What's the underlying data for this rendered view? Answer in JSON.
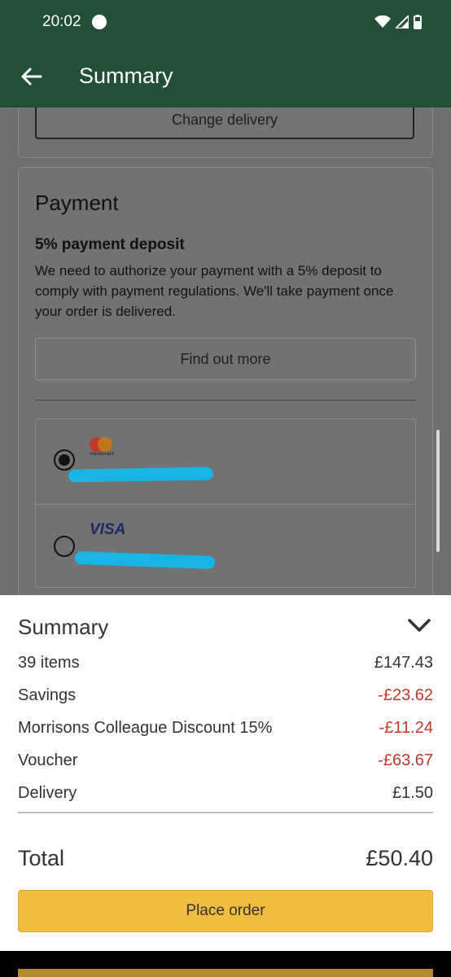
{
  "status_bar": {
    "time": "20:02"
  },
  "app_bar": {
    "title": "Summary"
  },
  "delivery": {
    "change_label": "Change delivery"
  },
  "payment": {
    "title": "Payment",
    "deposit_title": "5% payment deposit",
    "deposit_text": "We need to authorize your payment with a 5% deposit to comply with payment regulations. We'll take payment once your order is delivered.",
    "find_out_label": "Find out more",
    "cards": [
      {
        "brand": "mastercard",
        "selected": true
      },
      {
        "brand": "VISA",
        "selected": false
      }
    ]
  },
  "summary": {
    "title": "Summary",
    "rows": [
      {
        "label": "39 items",
        "value": "£147.43",
        "type": "pos"
      },
      {
        "label": "Savings",
        "value": "-£23.62",
        "type": "neg"
      },
      {
        "label": "Morrisons Colleague Discount 15%",
        "value": "-£11.24",
        "type": "neg"
      },
      {
        "label": "Voucher",
        "value": "-£63.67",
        "type": "neg"
      },
      {
        "label": "Delivery",
        "value": "£1.50",
        "type": "pos"
      }
    ],
    "total_label": "Total",
    "total_value": "£50.40",
    "place_order_label": "Place order"
  },
  "colors": {
    "header_green": "#234f37",
    "negative_red": "#c0392b",
    "button_yellow": "#f1bc3f",
    "redaction_blue": "#19b4e6"
  }
}
